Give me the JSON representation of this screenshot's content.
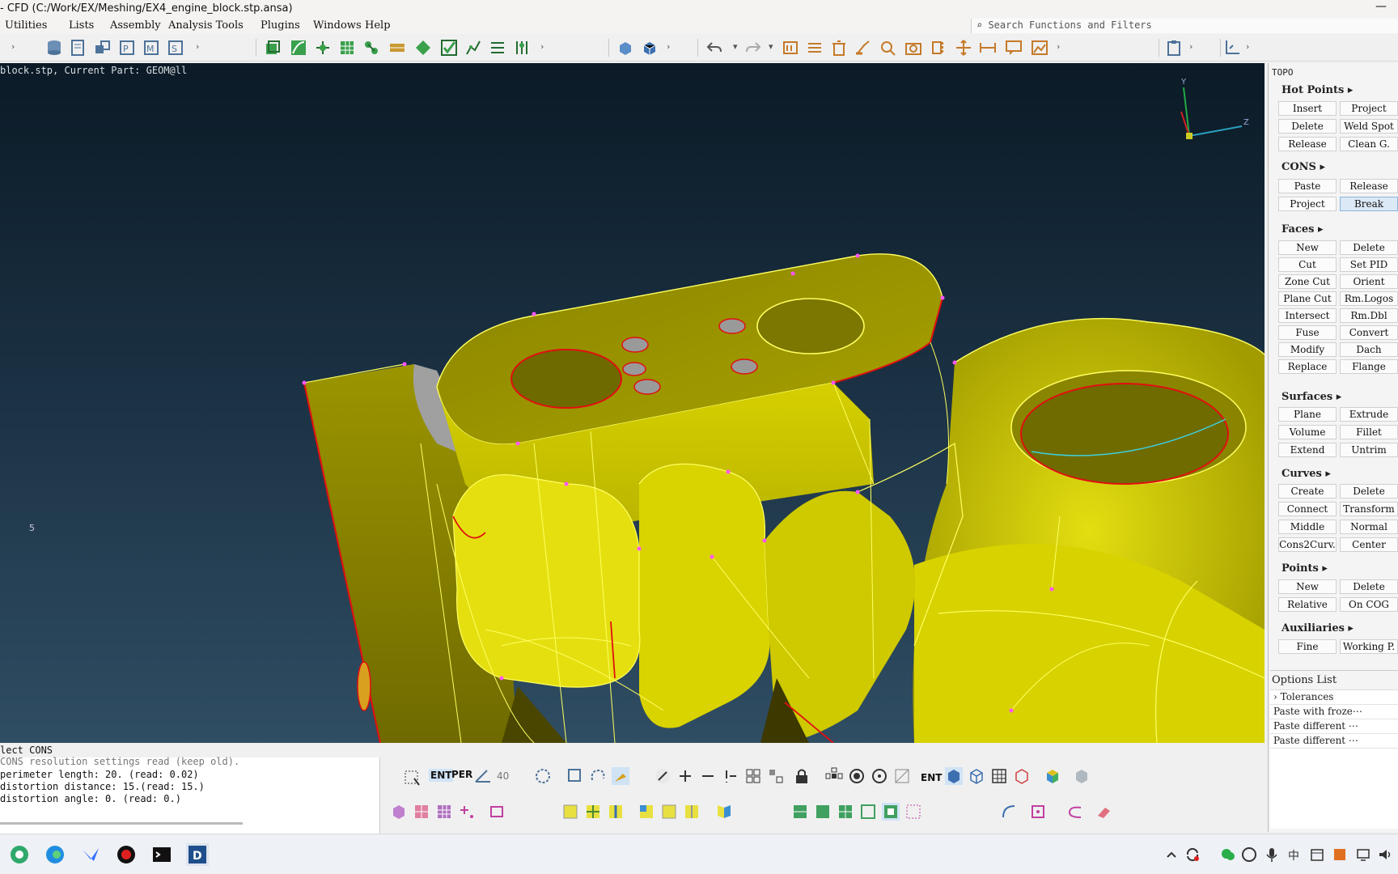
{
  "window": {
    "title": "- CFD (C:/Work/EX/Meshing/EX4_engine_block.stp.ansa)",
    "minimize_glyph": "—"
  },
  "menu": {
    "items": [
      "Utilities",
      "Lists",
      "Assembly",
      "Analysis Tools",
      "Plugins",
      "Windows",
      "Help"
    ],
    "search_placeholder": "Search Functions and Filters"
  },
  "viewport": {
    "info": "block.stp,  Current Part: GEOM@ll",
    "label_5": "5",
    "axes": {
      "y": "Y",
      "z": "Z"
    },
    "colors": {
      "surface": "#c8c200",
      "edge": "#ffff60",
      "boundary": "#e01010",
      "background_top": "#0b1a26"
    }
  },
  "right_panel": {
    "header": "TOPO",
    "sections": {
      "hot_points": "Hot Points ▸",
      "cons": "CONS ▸",
      "faces": "Faces ▸",
      "surfaces": "Surfaces ▸",
      "curves": "Curves ▸",
      "points": "Points ▸",
      "auxiliaries": "Auxiliaries ▸"
    },
    "buttons": {
      "hp_insert": "Insert",
      "hp_project": "Project",
      "hp_delete": "Delete",
      "hp_weld": "Weld Spot",
      "hp_release": "Release",
      "hp_clean": "Clean G.",
      "cons_paste": "Paste",
      "cons_release": "Release",
      "cons_project": "Project",
      "cons_break": "Break",
      "f_new": "New",
      "f_delete": "Delete",
      "f_cut": "Cut",
      "f_setpid": "Set PID",
      "f_zonecut": "Zone Cut",
      "f_orient": "Orient",
      "f_planecut": "Plane Cut",
      "f_rmlogos": "Rm.Logos",
      "f_intersect": "Intersect",
      "f_rmdbl": "Rm.Dbl",
      "f_fuse": "Fuse",
      "f_convert": "Convert",
      "f_modify": "Modify",
      "f_dach": "Dach",
      "f_replace": "Replace",
      "f_flange": "Flange",
      "s_plane": "Plane",
      "s_extrude": "Extrude",
      "s_volume": "Volume",
      "s_fillet": "Fillet",
      "s_extend": "Extend",
      "s_untrim": "Untrim",
      "c_create": "Create",
      "c_delete": "Delete",
      "c_connect": "Connect",
      "c_transform": "Transform",
      "c_middle": "Middle",
      "c_normal": "Normal",
      "c_cons2curv": "Cons2Curv.",
      "c_center": "Center",
      "p_new": "New",
      "p_delete": "Delete",
      "p_relative": "Relative",
      "p_oncog": "On COG",
      "a_fine": "Fine",
      "a_working": "Working P."
    },
    "options_list": {
      "title": "Options List",
      "items": [
        "Tolerances",
        "Paste with froze⋯",
        "Paste different ⋯",
        "Paste different ⋯"
      ]
    }
  },
  "select_bar": "lect CONS",
  "console": {
    "lines": [
      "CONS resolution settings read (keep old).",
      "perimeter length: 20. (read: 0.02)",
      "distortion distance: 15.(read: 15.)",
      "distortion angle: 0. (read: 0.)"
    ]
  },
  "bottom_toolbar": {
    "ent": "ENT",
    "per": "PER",
    "angle": "40",
    "ent2": "ENT"
  }
}
